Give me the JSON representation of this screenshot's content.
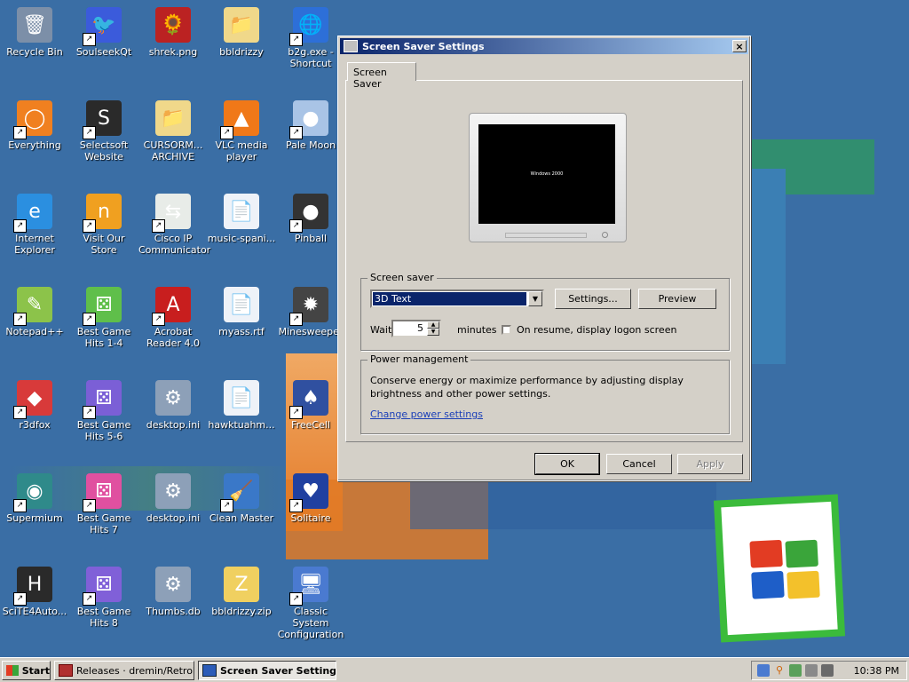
{
  "desktop": {
    "icons": [
      {
        "label": "Recycle Bin",
        "icon": "recycle-bin-icon",
        "glyph": "🗑",
        "color": "#7c8fa8",
        "shortcut": false
      },
      {
        "label": "SoulseekQt",
        "icon": "soulseek-bird-icon",
        "glyph": "🐦",
        "color": "#3b5bdb",
        "shortcut": true
      },
      {
        "label": "shrek.png",
        "icon": "image-file-icon",
        "glyph": "🌻",
        "color": "#b22",
        "shortcut": false
      },
      {
        "label": "bbldrizzy",
        "icon": "folder-icon",
        "glyph": "📁",
        "color": "#f0d88a",
        "shortcut": false
      },
      {
        "label": "b2g.exe - Shortcut",
        "icon": "b2g-exe-icon",
        "glyph": "🌐",
        "color": "#2d6fd8",
        "shortcut": true
      },
      {
        "label": "Everything",
        "icon": "search-magnifier-icon",
        "glyph": "◯",
        "color": "#f08020",
        "shortcut": true
      },
      {
        "label": "Selectsoft Website",
        "icon": "selectsoft-icon",
        "glyph": "S",
        "color": "#2a2a2a",
        "shortcut": true
      },
      {
        "label": "CURSORM... ARCHIVE",
        "icon": "folder-icon",
        "glyph": "📁",
        "color": "#f0d88a",
        "shortcut": false
      },
      {
        "label": "VLC media player",
        "icon": "vlc-cone-icon",
        "glyph": "▲",
        "color": "#f07818",
        "shortcut": true
      },
      {
        "label": "Pale Moon",
        "icon": "pale-moon-icon",
        "glyph": "●",
        "color": "#a9c4e6",
        "shortcut": true
      },
      {
        "label": "Internet Explorer",
        "icon": "internet-explorer-icon",
        "glyph": "e",
        "color": "#2b8fe0",
        "shortcut": true
      },
      {
        "label": "Visit Our Store",
        "icon": "store-icon",
        "glyph": "n",
        "color": "#f0a020",
        "shortcut": true
      },
      {
        "label": "Cisco IP Communicator",
        "icon": "cisco-ip-icon",
        "glyph": "⇆",
        "color": "#e8ece8",
        "shortcut": true
      },
      {
        "label": "music-spani...",
        "icon": "document-icon",
        "glyph": "📄",
        "color": "#eef2f8",
        "shortcut": false
      },
      {
        "label": "Pinball",
        "icon": "pinball-icon",
        "glyph": "●",
        "color": "#333",
        "shortcut": true
      },
      {
        "label": "Notepad++",
        "icon": "notepad-plus-plus-icon",
        "glyph": "✎",
        "color": "#8cc34a",
        "shortcut": true
      },
      {
        "label": "Best Game Hits 1-4",
        "icon": "dice-green-icon",
        "glyph": "⚄",
        "color": "#5fbf4a",
        "shortcut": true
      },
      {
        "label": "Acrobat Reader 4.0",
        "icon": "acrobat-icon",
        "glyph": "A",
        "color": "#c81e1e",
        "shortcut": true
      },
      {
        "label": "myass.rtf",
        "icon": "rtf-document-icon",
        "glyph": "📄",
        "color": "#eef2f8",
        "shortcut": false
      },
      {
        "label": "Minesweeper",
        "icon": "mine-icon",
        "glyph": "✹",
        "color": "#444",
        "shortcut": true
      },
      {
        "label": "r3dfox",
        "icon": "r3dfox-icon",
        "glyph": "◆",
        "color": "#d83a3a",
        "shortcut": true
      },
      {
        "label": "Best Game Hits 5-6",
        "icon": "dice-purple-icon",
        "glyph": "⚄",
        "color": "#7b5fd6",
        "shortcut": true
      },
      {
        "label": "desktop.ini",
        "icon": "settings-file-icon",
        "glyph": "⚙",
        "color": "#8da0b8",
        "shortcut": false
      },
      {
        "label": "hawktuahm...",
        "icon": "document-icon",
        "glyph": "📄",
        "color": "#eef2f8",
        "shortcut": false
      },
      {
        "label": "FreeCell",
        "icon": "freecell-icon",
        "glyph": "♠",
        "color": "#3050a0",
        "shortcut": true
      },
      {
        "label": "Supermium",
        "icon": "supermium-icon",
        "glyph": "◉",
        "color": "#2f8a8a",
        "shortcut": true
      },
      {
        "label": "Best Game Hits 7",
        "icon": "dice-pink-icon",
        "glyph": "⚄",
        "color": "#e050a0",
        "shortcut": true
      },
      {
        "label": "desktop.ini",
        "icon": "settings-file-icon",
        "glyph": "⚙",
        "color": "#8da0b8",
        "shortcut": false
      },
      {
        "label": "Clean Master",
        "icon": "broom-icon",
        "glyph": "🧹",
        "color": "#3a78c8",
        "shortcut": true
      },
      {
        "label": "Solitaire",
        "icon": "solitaire-icon",
        "glyph": "♥",
        "color": "#2040a0",
        "shortcut": true
      },
      {
        "label": "SciTE4Auto...",
        "icon": "scite-icon",
        "glyph": "H",
        "color": "#2a2a2a",
        "shortcut": true
      },
      {
        "label": "Best Game Hits 8",
        "icon": "dice-violet-icon",
        "glyph": "⚄",
        "color": "#8060d8",
        "shortcut": true
      },
      {
        "label": "Thumbs.db",
        "icon": "settings-file-icon",
        "glyph": "⚙",
        "color": "#8da0b8",
        "shortcut": false
      },
      {
        "label": "bbldrizzy.zip",
        "icon": "zip-folder-icon",
        "glyph": "Z",
        "color": "#f0d060",
        "shortcut": false
      },
      {
        "label": "Classic System Configuration",
        "icon": "system-config-icon",
        "glyph": "🖥",
        "color": "#4a7ad0",
        "shortcut": true
      }
    ]
  },
  "dialog": {
    "title": "Screen Saver Settings",
    "close_label": "×",
    "tab_label": "Screen Saver",
    "preview_text": "Windows 2000",
    "screensaver_group": {
      "legend": "Screen saver",
      "selected": "3D Text",
      "settings_button": "Settings...",
      "preview_button": "Preview",
      "wait_label": "Wait:",
      "wait_value": "5",
      "minutes_label": "minutes",
      "resume_checked": false,
      "resume_label": "On resume, display logon screen"
    },
    "power_group": {
      "legend": "Power management",
      "description": "Conserve energy or maximize performance by adjusting display brightness and other power settings.",
      "link": "Change power settings"
    },
    "buttons": {
      "ok": "OK",
      "cancel": "Cancel",
      "apply": "Apply"
    }
  },
  "taskbar": {
    "start_label": "Start",
    "tasks": [
      {
        "label": "Releases · dremin/RetroB...",
        "active": false
      },
      {
        "label": "Screen Saver Settings",
        "active": true
      }
    ],
    "tray_icons": [
      "upload-icon",
      "search-icon",
      "network-icon",
      "display-icon",
      "monitor-icon"
    ],
    "clock": "10:38 PM"
  }
}
